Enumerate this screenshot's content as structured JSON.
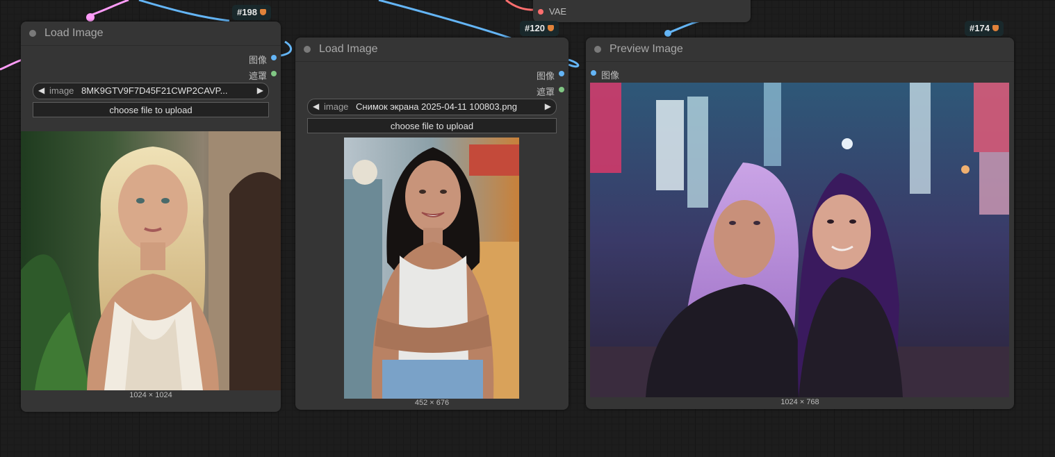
{
  "canvas": {
    "wire_colors": {
      "image": "#64b5f6",
      "latent": "#ff9cf9"
    }
  },
  "vae_node": {
    "input_label": "VAE",
    "input_color": "#ff6e6e"
  },
  "nodes": [
    {
      "badge": "#198",
      "title": "Load Image",
      "outputs": [
        {
          "label": "图像",
          "type": "IMAGE"
        },
        {
          "label": "遮罩",
          "type": "MASK"
        }
      ],
      "widget": {
        "name": "image",
        "value": "8MK9GTV9F7D45F21CWP2CAVP..."
      },
      "upload_button": "choose file to upload",
      "image_dims": "1024 × 1024"
    },
    {
      "badge": "#120",
      "title": "Load Image",
      "outputs": [
        {
          "label": "图像",
          "type": "IMAGE"
        },
        {
          "label": "遮罩",
          "type": "MASK"
        }
      ],
      "widget": {
        "name": "image",
        "value": "Снимок экрана 2025-04-11 100803.png"
      },
      "upload_button": "choose file to upload",
      "image_dims": "452 × 676"
    },
    {
      "badge": "#174",
      "title": "Preview Image",
      "inputs": [
        {
          "label": "图像",
          "type": "IMAGE"
        }
      ],
      "image_dims": "1024 × 768"
    }
  ]
}
